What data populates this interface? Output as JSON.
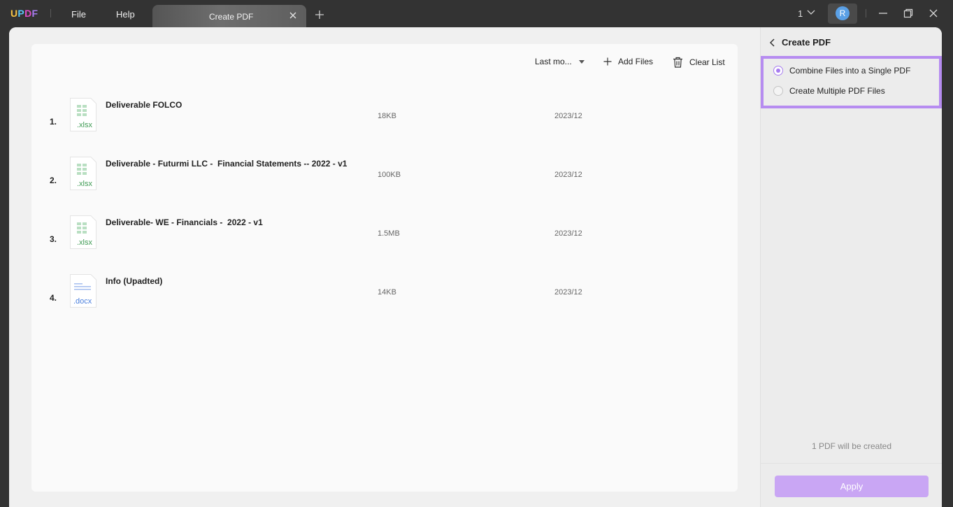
{
  "titlebar": {
    "logo_letters": [
      "U",
      "P",
      "D",
      "F"
    ],
    "logo_colors": [
      "#f6c343",
      "#57c5f7",
      "#e04dc9",
      "#a77cf0"
    ],
    "menu": [
      "File",
      "Help"
    ],
    "tab_label": "Create PDF",
    "page_count": "1",
    "avatar_letter": "R"
  },
  "toolbar": {
    "sort_label": "Last mo...",
    "add_files_label": "Add Files",
    "clear_list_label": "Clear List"
  },
  "files": [
    {
      "num": "1.",
      "name": "Deliverable FOLCO",
      "ext": ".xlsx",
      "type": "xlsx",
      "size": "18KB",
      "date": "2023/12"
    },
    {
      "num": "2.",
      "name": "Deliverable - Futurmi LLC -  Financial Statements -- 2022 - v1",
      "ext": ".xlsx",
      "type": "xlsx",
      "size": "100KB",
      "date": "2023/12"
    },
    {
      "num": "3.",
      "name": "Deliverable- WE - Financials -  2022 - v1",
      "ext": ".xlsx",
      "type": "xlsx",
      "size": "1.5MB",
      "date": "2023/12"
    },
    {
      "num": "4.",
      "name": "Info (Upadted)",
      "ext": ".docx",
      "type": "docx",
      "size": "14KB",
      "date": "2023/12"
    }
  ],
  "side": {
    "title": "Create PDF",
    "option_single": "Combine Files into a Single PDF",
    "option_multiple": "Create Multiple PDF Files",
    "selected": "single",
    "note": "1 PDF will be created",
    "apply_label": "Apply"
  },
  "colors": {
    "accent": "#a77cf0",
    "apply_bg": "#c9a6f4",
    "xlsx_green": "#3f9b54",
    "docx_blue": "#4a7fdd"
  }
}
